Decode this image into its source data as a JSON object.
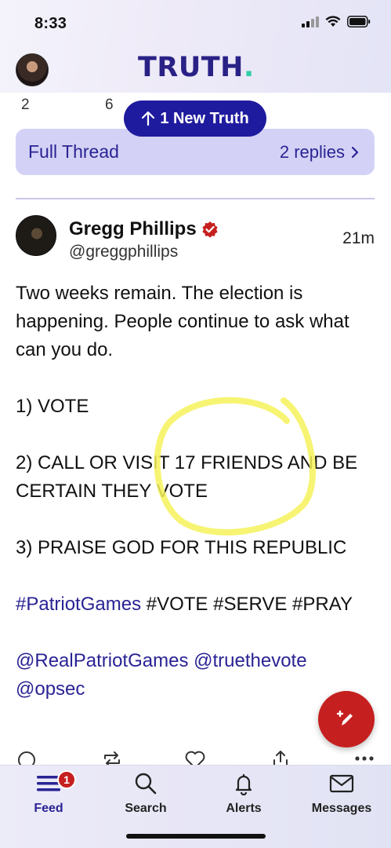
{
  "status_bar": {
    "time": "8:33"
  },
  "header": {
    "logo_text": "TRUTH",
    "logo_dot": "."
  },
  "counts_row": [
    "2",
    "6"
  ],
  "new_truth": {
    "label": "1 New Truth"
  },
  "thread": {
    "full_thread_label": "Full Thread",
    "replies_label": "2 replies"
  },
  "post": {
    "author_name": "Gregg Phillips",
    "handle": "@greggphillips",
    "time": "21m",
    "lines": {
      "intro": "Two weeks remain. The election is happening. People continue to ask what can you do.",
      "item1": "1) VOTE",
      "item2": "2) CALL OR VISIT 17 FRIENDS AND BE CERTAIN THEY VOTE",
      "item3": "3) PRAISE GOD FOR THIS REPUBLIC"
    },
    "hashtags": {
      "linked": "#PatriotGames",
      "plain": " #VOTE #SERVE #PRAY"
    },
    "mentions": {
      "m1": "@RealPatriotGames",
      "m2": "@truethevote",
      "m3": "@opsec"
    }
  },
  "tabs": [
    {
      "label": "Feed",
      "icon": "feed-icon",
      "badge": "1"
    },
    {
      "label": "Search",
      "icon": "search-icon"
    },
    {
      "label": "Alerts",
      "icon": "bell-icon"
    },
    {
      "label": "Messages",
      "icon": "mail-icon"
    }
  ],
  "colors": {
    "brand": "#2a2186",
    "accent_red": "#c5201f",
    "link": "#2a2394",
    "annotation": "#f6f25a"
  }
}
